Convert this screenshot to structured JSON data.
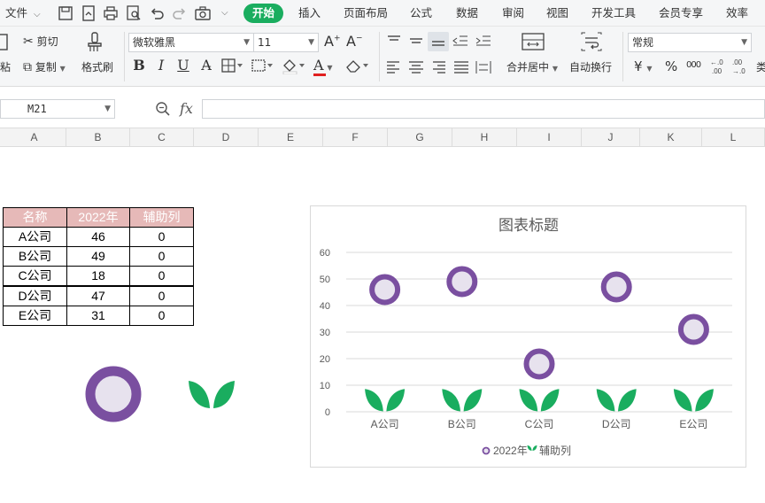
{
  "menubar": {
    "file_label": "文件",
    "tabs": [
      "开始",
      "插入",
      "页面布局",
      "公式",
      "数据",
      "审阅",
      "视图",
      "开发工具",
      "会员专享",
      "效率"
    ],
    "active_tab": "开始"
  },
  "ribbon": {
    "paste_label": "粘",
    "cut_label": "剪切",
    "copy_label": "复制",
    "format_painter_label": "格式刷",
    "font_name": "微软雅黑",
    "font_size": "11",
    "merge_label": "合并居中",
    "wrap_label": "自动换行",
    "number_format": "常规",
    "currency_symbol": "¥",
    "percent_symbol": "%",
    "thousands_symbol": "000",
    "overflow_label": "类"
  },
  "formula_bar": {
    "cell_reference": "M21",
    "fx_label": "fx",
    "formula_value": ""
  },
  "grid": {
    "columns": [
      "A",
      "B",
      "C",
      "D",
      "E",
      "F",
      "G",
      "H",
      "I",
      "J",
      "K",
      "L"
    ]
  },
  "table": {
    "headers": [
      "名称",
      "2022年",
      "辅助列"
    ],
    "rows": [
      [
        "A公司",
        "46",
        "0"
      ],
      [
        "B公司",
        "49",
        "0"
      ],
      [
        "C公司",
        "18",
        "0"
      ],
      [
        "D公司",
        "47",
        "0"
      ],
      [
        "E公司",
        "31",
        "0"
      ]
    ],
    "header_color": "#e6b9b8"
  },
  "colors": {
    "accent": "#1aad5f",
    "circle_ring": "#7a4fa0",
    "circle_fill": "#e7e2ee",
    "leaf": "#1aad5f"
  },
  "chart_data": {
    "type": "scatter",
    "title": "图表标题",
    "categories": [
      "A公司",
      "B公司",
      "C公司",
      "D公司",
      "E公司"
    ],
    "series": [
      {
        "name": "2022年",
        "values": [
          46,
          49,
          18,
          47,
          31
        ],
        "marker": "purple-ring-circle"
      },
      {
        "name": "辅助列",
        "values": [
          0,
          0,
          0,
          0,
          0
        ],
        "marker": "green-leaf"
      }
    ],
    "ylim": [
      0,
      60
    ],
    "yticks": [
      0,
      10,
      20,
      30,
      40,
      50,
      60
    ],
    "grid": true,
    "legend": "bottom"
  }
}
